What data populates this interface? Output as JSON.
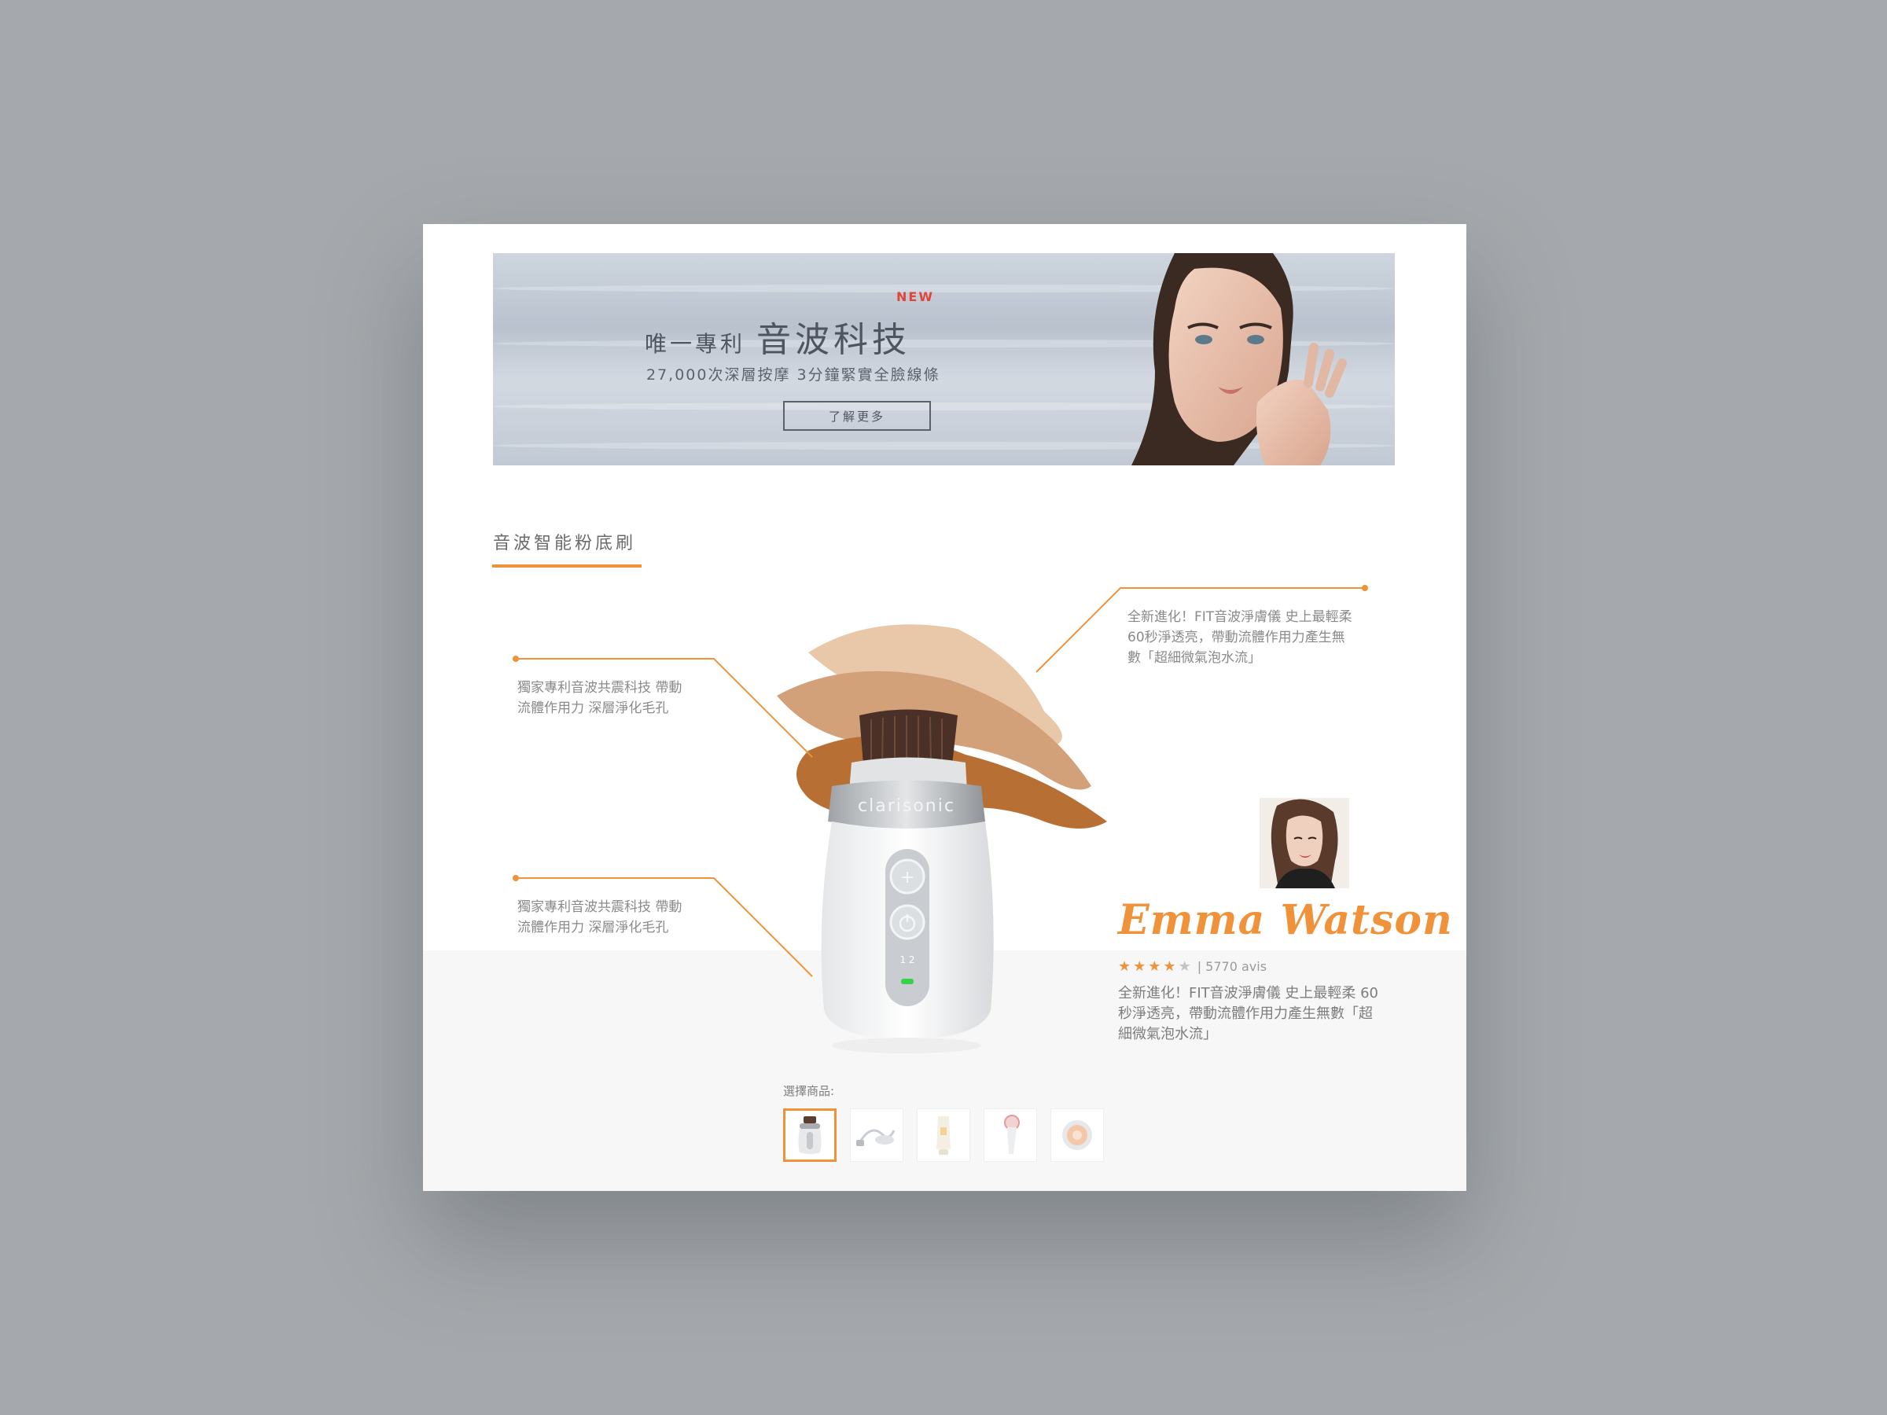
{
  "banner": {
    "new_badge": "NEW",
    "title_small": "唯一專利",
    "title_large": "音波科技",
    "subtitle": "27,000次深層按摩 3分鐘緊實全臉線條",
    "button_label": "了解更多"
  },
  "section": {
    "title": "音波智能粉底刷"
  },
  "product": {
    "brand": "clarisonic",
    "speed_labels": "1 2"
  },
  "callouts": {
    "left_top": {
      "line1": "獨家專利音波共震科技 帶動",
      "line2": "流體作用力 深層淨化毛孔"
    },
    "left_bottom": {
      "line1": "獨家專利音波共震科技 帶動",
      "line2": "流體作用力 深層淨化毛孔"
    },
    "right_top": {
      "line1": "全新進化！FIT音波淨膚儀 史上最輕柔",
      "line2": "60秒淨透亮，帶動流體作用力產生無",
      "line3": "數「超細微氣泡水流」"
    }
  },
  "endorsement": {
    "name": "Emma Watson",
    "rating": 4,
    "rating_max": 5,
    "reviews": "| 5770 avis",
    "description": "全新進化！FIT音波淨膚儀 史上最輕柔 60秒淨透亮，帶動流體作用力產生無數「超細微氣泡水流」"
  },
  "selector": {
    "label": "選擇商品:",
    "items": [
      {
        "icon": "brush-device-thumb",
        "selected": true
      },
      {
        "icon": "charger-cable-thumb",
        "selected": false
      },
      {
        "icon": "cream-tube-thumb",
        "selected": false
      },
      {
        "icon": "handheld-brush-thumb",
        "selected": false
      },
      {
        "icon": "brush-head-thumb",
        "selected": false
      }
    ]
  },
  "colors": {
    "accent": "#f0923a",
    "badge_red": "#e0453a",
    "background": "#a5a9ad"
  }
}
